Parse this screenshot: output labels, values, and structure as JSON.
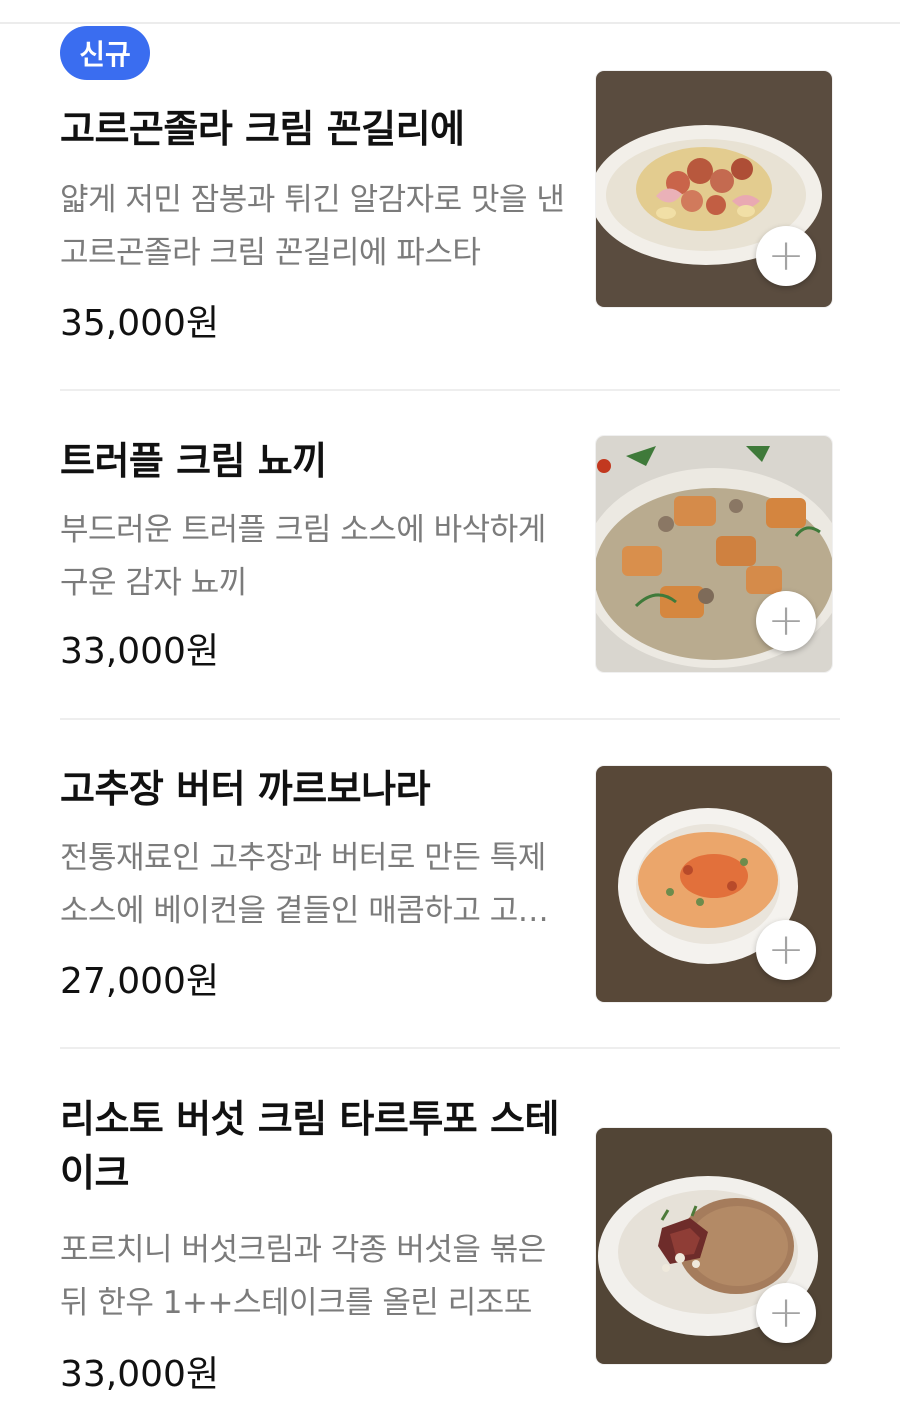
{
  "menu": {
    "items": [
      {
        "badge": "신규",
        "name": "고르곤졸라 크림 꼰길리에",
        "description": "얇게 저민 잠봉과 튀긴 알감자로 맛을 낸 고르곤졸라 크림 꼰길리에  파스타",
        "price": "35,000원",
        "image_icon": "pasta-conchiglie-dish"
      },
      {
        "name": "트러플 크림 뇨끼",
        "description": "부드러운 트러플 크림 소스에 바삭하게 구운 감자 뇨끼",
        "price": "33,000원",
        "image_icon": "truffle-gnocchi-dish"
      },
      {
        "name": "고추장 버터 까르보나라",
        "description": "전통재료인 고추장과 버터로 만든 특제 소스에 베이컨을 곁들인 매콤하고 고…",
        "price": "27,000원",
        "image_icon": "gochujang-carbonara-dish"
      },
      {
        "name": "리소토 버섯 크림 타르투포 스테이크",
        "description": "포르치니 버섯크림과 각종 버섯을 볶은 뒤 한우 1++스테이크를 올린 리조또",
        "price": "33,000원",
        "image_icon": "risotto-steak-dish"
      }
    ],
    "add_button_icon": "plus-icon"
  },
  "colors": {
    "badge": "#3a6df0",
    "description": "#7b7b7b",
    "divider": "#eeeeee"
  }
}
